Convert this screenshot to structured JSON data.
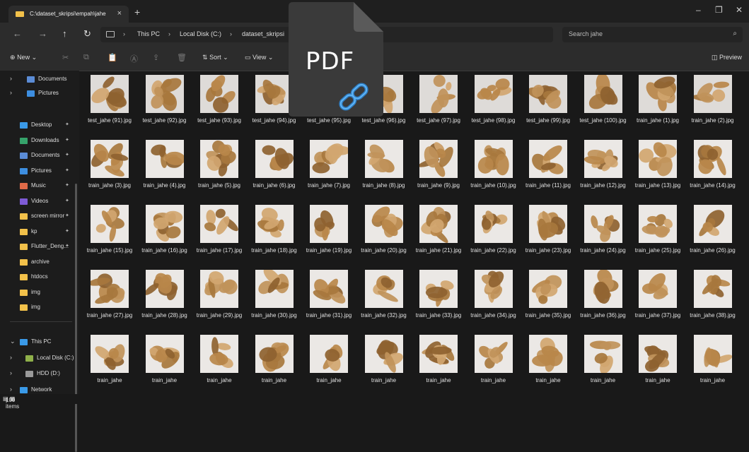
{
  "window": {
    "tab_title": "C:\\dataset_skripsi\\empah\\jahe",
    "tab_close": "×",
    "new_tab": "+",
    "minimize": "–",
    "maximize": "❐",
    "close": "✕"
  },
  "nav": {
    "back": "←",
    "forward": "→",
    "up": "↑",
    "refresh": "↻"
  },
  "breadcrumb": [
    "This PC",
    "Local Disk (C:)",
    "dataset_skripsi"
  ],
  "breadcrumb_sep": "›",
  "search": {
    "placeholder": "Search jahe",
    "icon": "⌕"
  },
  "toolbar": {
    "new_label": "New",
    "sort_label": "Sort",
    "view_label": "View",
    "preview_label": "Preview"
  },
  "sidebar": {
    "top": [
      {
        "label": "Documents",
        "icon": "documents-icon",
        "color": "#5b8cd6"
      },
      {
        "label": "Pictures",
        "icon": "pictures-icon",
        "color": "#3d8ee0"
      }
    ],
    "quick": [
      {
        "label": "Desktop",
        "icon": "desktop-icon",
        "color": "#3a9ae8"
      },
      {
        "label": "Downloads",
        "icon": "downloads-icon",
        "color": "#36a36b"
      },
      {
        "label": "Documents",
        "icon": "documents-icon",
        "color": "#5b8cd6"
      },
      {
        "label": "Pictures",
        "icon": "pictures-icon",
        "color": "#3d8ee0"
      },
      {
        "label": "Music",
        "icon": "music-icon",
        "color": "#e06a48"
      },
      {
        "label": "Videos",
        "icon": "videos-icon",
        "color": "#7e5bd6"
      },
      {
        "label": "screen mirror",
        "icon": "folder-icon",
        "color": "#f2c14a"
      },
      {
        "label": "kp",
        "icon": "folder-icon",
        "color": "#f2c14a"
      },
      {
        "label": "Flutter_Deng...",
        "icon": "folder-icon",
        "color": "#f2c14a"
      },
      {
        "label": "archive",
        "icon": "folder-icon",
        "color": "#f2c14a"
      },
      {
        "label": "htdocs",
        "icon": "folder-icon",
        "color": "#f2c14a"
      },
      {
        "label": "img",
        "icon": "folder-icon",
        "color": "#f2c14a"
      },
      {
        "label": "img",
        "icon": "folder-icon",
        "color": "#f2c14a"
      }
    ],
    "bottom": [
      {
        "label": "This PC",
        "chev": "⌄"
      },
      {
        "label": "Local Disk (C:)",
        "chev": "›"
      },
      {
        "label": "HDD (D:)",
        "chev": "›"
      },
      {
        "label": "Network",
        "chev": "›"
      }
    ]
  },
  "files": [
    [
      "test_jahe (91).jpg",
      "test_jahe (92).jpg",
      "test_jahe (93).jpg",
      "test_jahe (94).jpg",
      "test_jahe (95).jpg",
      "test_jahe (96).jpg",
      "test_jahe (97).jpg",
      "test_jahe (98).jpg",
      "test_jahe (99).jpg",
      "test_jahe (100).jpg",
      "train_jahe (1).jpg",
      "train_jahe (2).jpg"
    ],
    [
      "train_jahe (3).jpg",
      "train_jahe (4).jpg",
      "train_jahe (5).jpg",
      "train_jahe (6).jpg",
      "train_jahe (7).jpg",
      "train_jahe (8).jpg",
      "train_jahe (9).jpg",
      "train_jahe (10).jpg",
      "train_jahe (11).jpg",
      "train_jahe (12).jpg",
      "train_jahe (13).jpg",
      "train_jahe (14).jpg"
    ],
    [
      "train_jahe (15).jpg",
      "train_jahe (16).jpg",
      "train_jahe (17).jpg",
      "train_jahe (18).jpg",
      "train_jahe (19).jpg",
      "train_jahe (20).jpg",
      "train_jahe (21).jpg",
      "train_jahe (22).jpg",
      "train_jahe (23).jpg",
      "train_jahe (24).jpg",
      "train_jahe (25).jpg",
      "train_jahe (26).jpg"
    ],
    [
      "train_jahe (27).jpg",
      "train_jahe (28).jpg",
      "train_jahe (29).jpg",
      "train_jahe (30).jpg",
      "train_jahe (31).jpg",
      "train_jahe (32).jpg",
      "train_jahe (33).jpg",
      "train_jahe (34).jpg",
      "train_jahe (35).jpg",
      "train_jahe (36).jpg",
      "train_jahe (37).jpg",
      "train_jahe (38).jpg"
    ],
    [
      "train_jahe",
      "train_jahe",
      "train_jahe",
      "train_jahe",
      "train_jahe",
      "train_jahe",
      "train_jahe",
      "train_jahe",
      "train_jahe",
      "train_jahe",
      "train_jahe",
      "train_jahe"
    ]
  ],
  "status": {
    "item_count": "100 items",
    "separator": "|"
  },
  "overlay": {
    "label": "PDF",
    "icon": "pdf-link-icon"
  },
  "colors": {
    "accent": "#4cc2ff",
    "folder": "#f2c14a",
    "ginger": "#b8874a"
  }
}
